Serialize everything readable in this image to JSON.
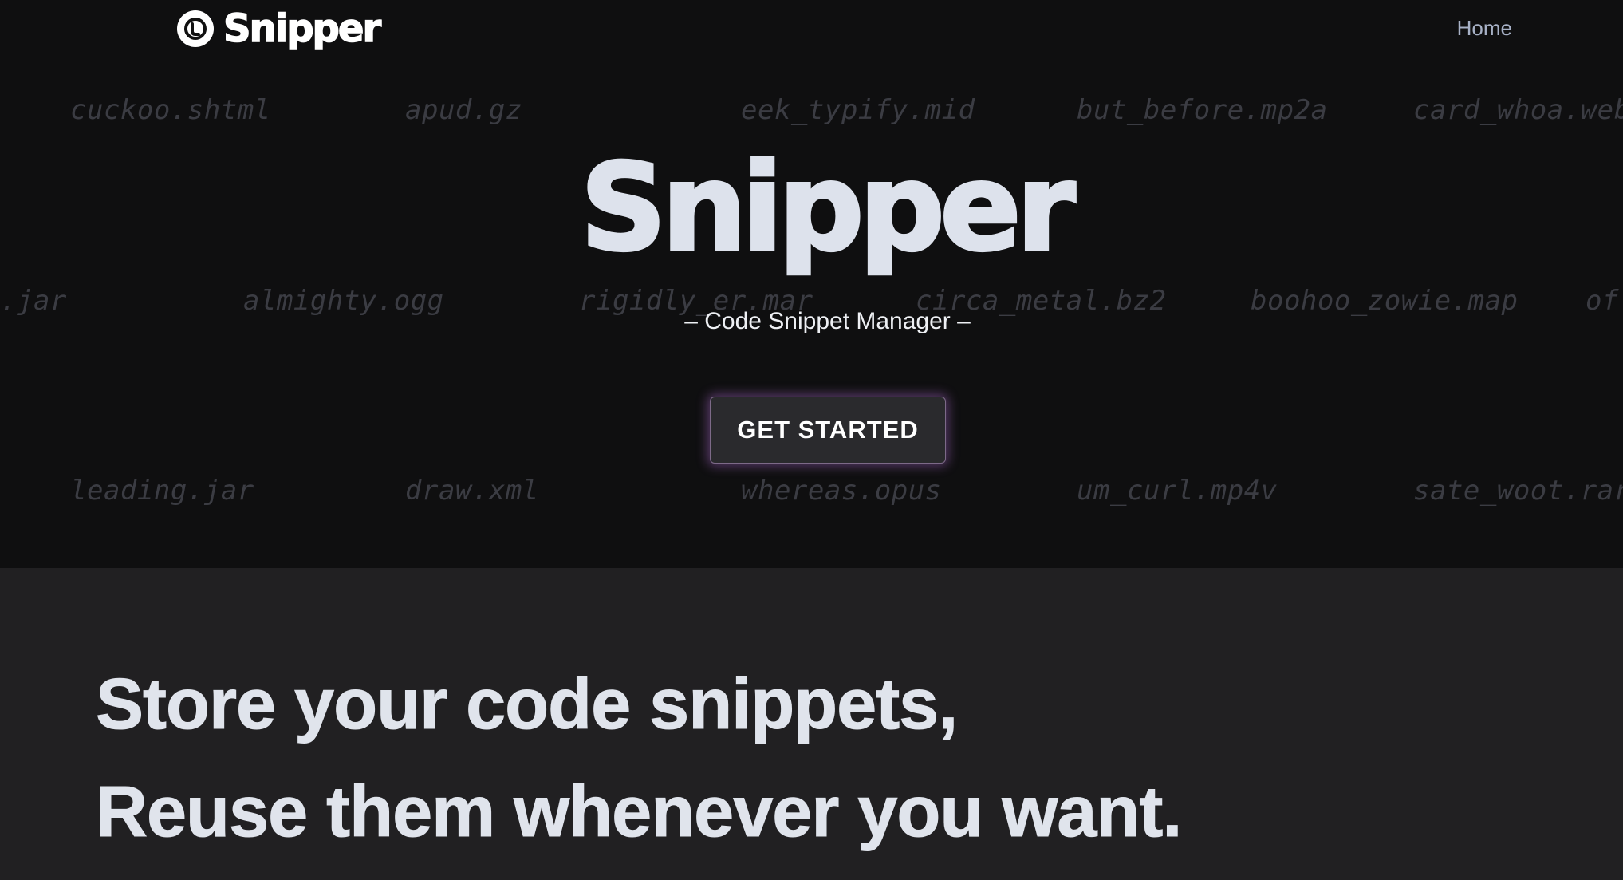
{
  "nav": {
    "brand": "Snipper",
    "brand_icon": "snipper-logo-icon",
    "home_link": "Home"
  },
  "background_files": [
    "cuckoo.shtml",
    "apud.gz",
    "eek_typify.mid",
    "but_before.mp2a",
    "card_whoa.webm",
    ".jar",
    "almighty.ogg",
    "rigidly_er.mar",
    "circa_metal.bz2",
    "boohoo_zowie.map",
    "of",
    "leading.jar",
    "draw.xml",
    "whereas.opus",
    "um_curl.mp4v",
    "sate_woot.rar"
  ],
  "hero": {
    "title": "Snipper",
    "subtitle": "– Code Snippet Manager –",
    "cta": "GET STARTED"
  },
  "feature": {
    "line1": "Store your code snippets,",
    "line2": "Reuse them whenever you want."
  },
  "colors": {
    "hero_bg": "#0f0f10",
    "feature_bg": "#212022",
    "text": "#dde2ec",
    "nav_link": "#a7b1c6",
    "cta_glow": "#b46ed7"
  }
}
